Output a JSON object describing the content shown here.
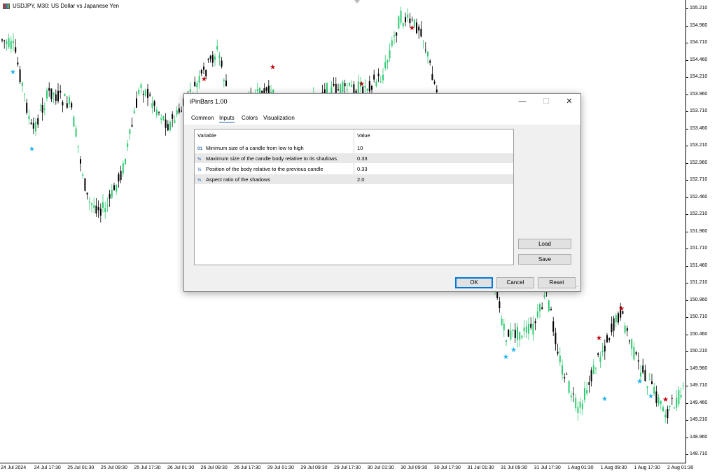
{
  "chart": {
    "title": "USDJPY, M30:  US Dollar vs Japanese Yen",
    "price_labels": [
      "155.210",
      "154.960",
      "154.710",
      "154.460",
      "154.210",
      "153.960",
      "153.710",
      "153.460",
      "153.210",
      "152.960",
      "152.710",
      "152.460",
      "152.210",
      "151.960",
      "151.710",
      "151.460",
      "151.210",
      "150.960",
      "150.710",
      "150.460",
      "150.210",
      "149.960",
      "149.710",
      "149.460",
      "149.210",
      "148.960",
      "148.710"
    ],
    "time_labels": [
      "24 Jul 2024",
      "24 Jul 17:30",
      "25 Jul 01:30",
      "25 Jul 09:30",
      "25 Jul 17:30",
      "26 Jul 01:30",
      "26 Jul 09:30",
      "26 Jul 17:30",
      "29 Jul 01:30",
      "29 Jul 09:30",
      "29 Jul 17:30",
      "30 Jul 01:30",
      "30 Jul 09:30",
      "30 Jul 17:30",
      "31 Jul 01:30",
      "31 Jul 09:30",
      "31 Jul 17:30",
      "1 Aug 01:30",
      "1 Aug 09:30",
      "1 Aug 17:30",
      "2 Aug 01:30"
    ],
    "colors": {
      "bull": "#2ecc71",
      "bear": "#000000",
      "star_up": "#c0000a",
      "star_down": "#1fb5e6"
    }
  },
  "dialog": {
    "title": "iPinBars 1.00",
    "tabs": [
      {
        "label": "Common"
      },
      {
        "label": "Inputs"
      },
      {
        "label": "Colors"
      },
      {
        "label": "Visualization"
      }
    ],
    "active_tab": "Inputs",
    "grid": {
      "headers": {
        "variable": "Variable",
        "value": "Value"
      },
      "rows": [
        {
          "icon": "01",
          "name": "Minimum size of a candle from low to high",
          "value": "10"
        },
        {
          "icon": "½",
          "name": "Maximum size of the candle body relative to its shadows",
          "value": "0.33"
        },
        {
          "icon": "½",
          "name": "Position of the body relative to the previous candle",
          "value": "0.33"
        },
        {
          "icon": "½",
          "name": "Aspect ratio of the shadows",
          "value": "2.0"
        }
      ]
    },
    "buttons": {
      "load": "Load",
      "save": "Save",
      "ok": "OK",
      "cancel": "Cancel",
      "reset": "Reset"
    },
    "window_controls": {
      "minimize": "—",
      "maximize": "☐",
      "close": "✕"
    }
  }
}
